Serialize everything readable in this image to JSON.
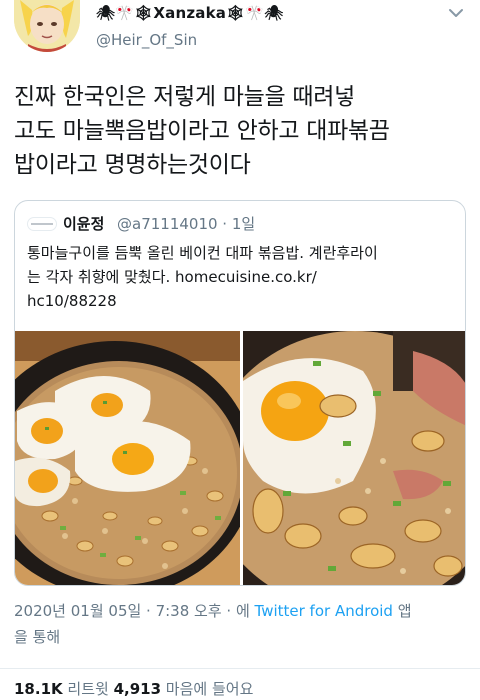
{
  "author": {
    "display_name": "🕷🎌🕸Xanzaka🕸🎌🕷",
    "handle": "@Heir_Of_Sin"
  },
  "tweet": {
    "lines": [
      "진짜 한국인은 저렇게 마늘을 때려넣",
      "고도 마늘뽁음밥이라고 안하고 대파볶끔",
      "밥이라고 명명하는것이다"
    ]
  },
  "quoted": {
    "name": "이윤정",
    "handle_time": "@a71114010 · 1일",
    "text_lines": [
      "통마늘구이를 듬뿍 올린 베이컨 대파 볶음밥. 계란후라이",
      "는 각자 취향에 맞췄다. homecuisine.co.kr/",
      "hc10/88228"
    ],
    "images": [
      "garlic-fried-rice-pan-photo",
      "garlic-fried-rice-closeup-photo"
    ]
  },
  "meta": {
    "date_time": "2020년 01월 05일 · 7:38 오후 · 에 ",
    "source": "Twitter for Android",
    "after_source": " 앱",
    "line2": "을 통해"
  },
  "stats": {
    "retweets": "18.1K",
    "retweets_label": " 리트윗  ",
    "likes": "4,913",
    "likes_label": " 마음에 들어요"
  },
  "colors": {
    "text": "#14171a",
    "secondary": "#657786",
    "link": "#1da1f2",
    "border": "#ccd6dd"
  },
  "icons": {
    "caret": "chevron-down-icon"
  }
}
